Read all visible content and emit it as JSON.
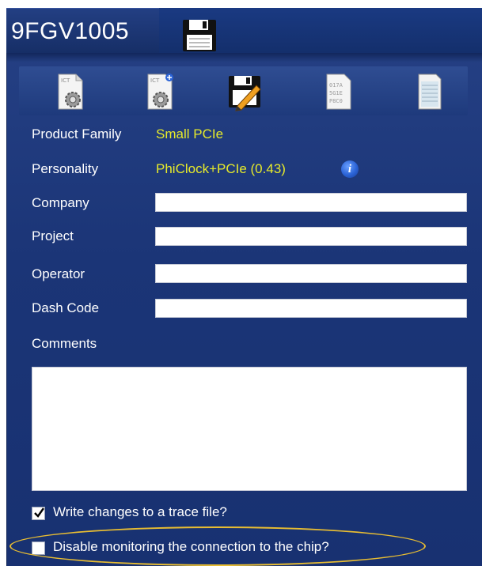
{
  "header": {
    "title": "9FGV1005",
    "save_icon": "floppy-disk-icon"
  },
  "toolbar": {
    "buttons": [
      {
        "name": "open-config",
        "icon": "document-gear-icon"
      },
      {
        "name": "new-config",
        "icon": "document-gear-plus-icon"
      },
      {
        "name": "save-edit",
        "icon": "floppy-pencil-icon"
      },
      {
        "name": "binary-data",
        "icon": "binary-document-icon"
      },
      {
        "name": "text-document",
        "icon": "document-icon"
      }
    ]
  },
  "form": {
    "product_family_label": "Product Family",
    "product_family_value": "Small PCIe",
    "personality_label": "Personality",
    "personality_value": "PhiClock+PCIe (0.43)",
    "info_glyph": "i",
    "company_label": "Company",
    "company_value": "",
    "project_label": "Project",
    "project_value": "",
    "operator_label": "Operator",
    "operator_value": "",
    "dash_code_label": "Dash Code",
    "dash_code_value": "",
    "comments_label": "Comments",
    "comments_value": ""
  },
  "options": {
    "trace_label": "Write changes to a trace file?",
    "trace_checked": true,
    "disable_monitoring_label": "Disable monitoring the connection to the chip?",
    "disable_monitoring_checked": false
  },
  "colors": {
    "panel": "#1b3577",
    "header": "#233f83",
    "value_text": "#e6ea2a",
    "highlight": "#e8bd32"
  }
}
